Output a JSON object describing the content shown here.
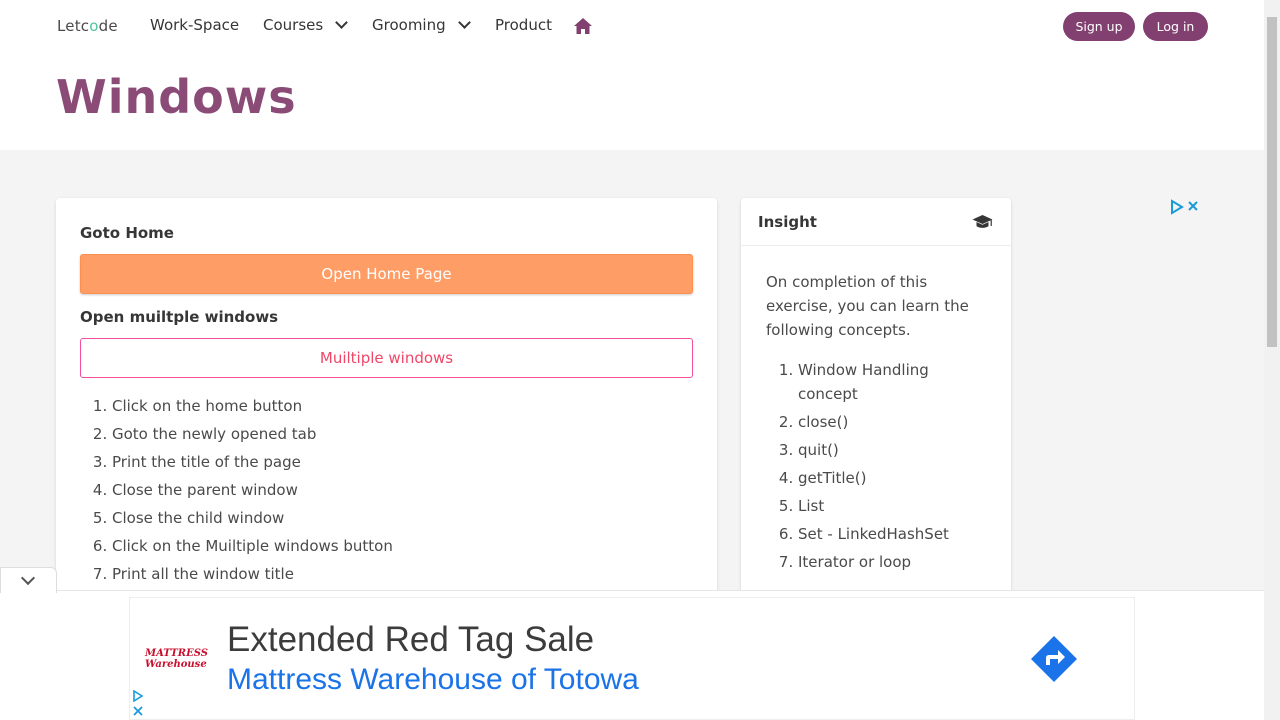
{
  "nav": {
    "logo_prefix": "Letc",
    "logo_o": "o",
    "logo_suffix": "de",
    "workspace": "Work-Space",
    "courses": "Courses",
    "grooming": "Grooming",
    "product": "Product",
    "home_icon": "home-icon",
    "signup": "Sign up",
    "login": "Log in"
  },
  "page": {
    "title": "Windows"
  },
  "main": {
    "goto_home_label": "Goto Home",
    "open_home_button": "Open Home Page",
    "multi_label": "Open muiltple windows",
    "multi_button": "Muiltiple windows",
    "steps": [
      "Click on the home button",
      "Goto the newly opened tab",
      "Print the title of the page",
      "Close the parent window",
      "Close the child window",
      "Click on the Muiltiple windows button",
      "Print all the window title"
    ]
  },
  "insight": {
    "title": "Insight",
    "icon": "graduation-cap-icon",
    "intro": "On completion of this exercise, you can learn the following concepts.",
    "concepts": [
      "Window Handling concept",
      "close()",
      "quit()",
      "getTitle()",
      "List",
      "Set - LinkedHashSet",
      "Iterator or loop"
    ]
  },
  "ad": {
    "logo_line1": "MATTRESS",
    "logo_line2": "Warehouse",
    "headline": "Extended Red Tag Sale",
    "subline": "Mattress Warehouse of Totowa"
  },
  "colors": {
    "brand_purple": "#8a4b76",
    "button_purple": "#814070",
    "orange": "#ff9d66",
    "pink": "#f14668",
    "ad_blue": "#1a73e8"
  }
}
